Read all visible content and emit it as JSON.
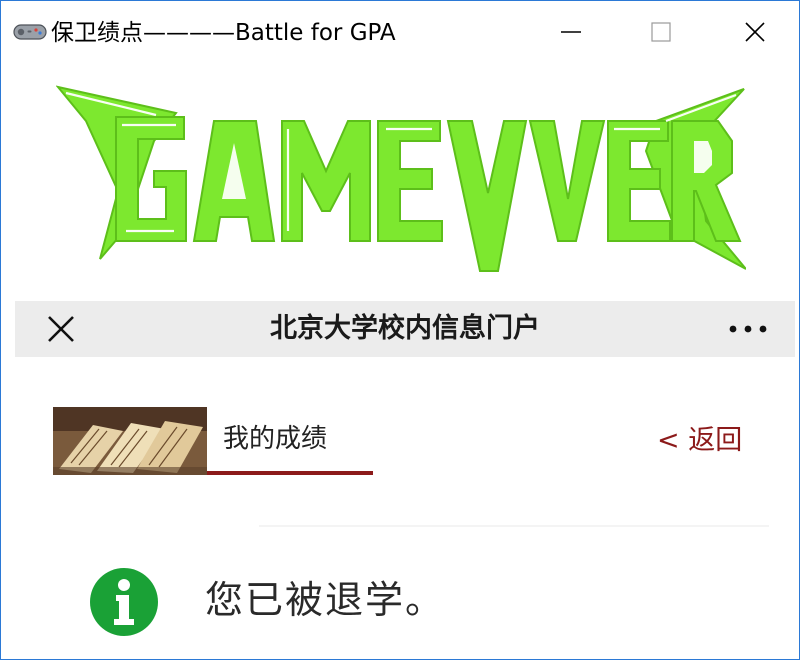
{
  "window": {
    "title": "保卫绩点————Battle for GPA",
    "icon": "gamepad-icon",
    "controls": [
      "minimize-icon",
      "maximize-icon",
      "close-icon"
    ]
  },
  "game_over": {
    "text": "GAME OVER",
    "color": "#7de82f",
    "outline_color": "#ffffff"
  },
  "portal": {
    "header_title": "北京大学校内信息门户",
    "close_icon": "close-icon",
    "more_icon": "more-dots-icon",
    "section_title": "我的成绩",
    "back_label": "< 返回",
    "accent_color": "#8c1a1a",
    "message": "您已被退学。",
    "message_icon": "info-icon",
    "message_icon_color": "#1aa136"
  }
}
